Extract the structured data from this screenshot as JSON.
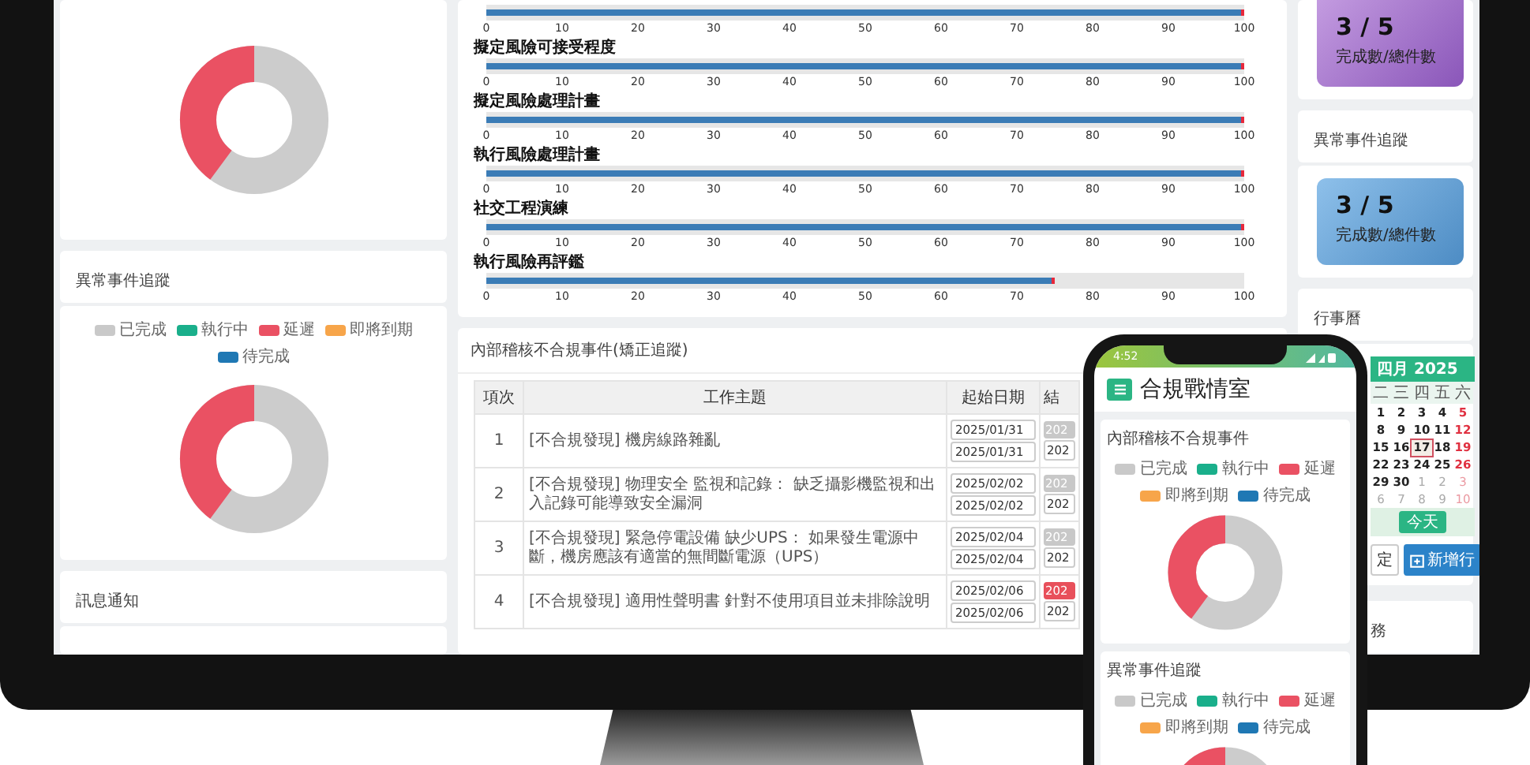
{
  "anomaly_card": {
    "title": "異常事件追蹤",
    "legend": [
      {
        "label": "已完成",
        "color": "#c9c9c9"
      },
      {
        "label": "執行中",
        "color": "#1aaf8b"
      },
      {
        "label": "延遲",
        "color": "#ea5163"
      },
      {
        "label": "即將到期",
        "color": "#f7a54a"
      },
      {
        "label": "待完成",
        "color": "#1f78b4"
      }
    ]
  },
  "notice_card": {
    "title": "訊息通知"
  },
  "risk_progress": [
    {
      "level": 1,
      "scale": [
        "0",
        "10",
        "20",
        "30",
        "40",
        "50",
        "60",
        "70",
        "80",
        "90",
        "100"
      ]
    },
    {
      "title": "擬定風險可接受程度",
      "level": 1,
      "scale": [
        "0",
        "10",
        "20",
        "30",
        "40",
        "50",
        "60",
        "70",
        "80",
        "90",
        "100"
      ]
    },
    {
      "title": "擬定風險處理計畫",
      "level": 1,
      "scale": [
        "0",
        "10",
        "20",
        "30",
        "40",
        "50",
        "60",
        "70",
        "80",
        "90",
        "100"
      ]
    },
    {
      "title": "執行風險處理計畫",
      "level": 1,
      "scale": [
        "0",
        "10",
        "20",
        "30",
        "40",
        "50",
        "60",
        "70",
        "80",
        "90",
        "100"
      ]
    },
    {
      "title": "社交工程演練",
      "level": 1,
      "scale": [
        "0",
        "10",
        "20",
        "30",
        "40",
        "50",
        "60",
        "70",
        "80",
        "90",
        "100"
      ]
    },
    {
      "title": "執行風險再評鑑",
      "level": 0.75,
      "scale": [
        "0",
        "10",
        "20",
        "30",
        "40",
        "50",
        "60",
        "70",
        "80",
        "90",
        "100"
      ]
    }
  ],
  "nonconformity_table": {
    "title": "內部稽核不合規事件(矯正追蹤)",
    "columns": [
      "項次",
      "工作主題",
      "起始日期",
      "結"
    ],
    "rows": [
      {
        "no": "1",
        "subject": "[不合規發現] 機房線路雜亂",
        "start_dates": [
          "2025/01/31",
          "2025/01/31"
        ],
        "end_badge": {
          "text": "202",
          "color": "#c8c8c8"
        },
        "end_date": "202"
      },
      {
        "no": "2",
        "subject": "[不合規發現] 物理安全 監視和記錄： 缺乏攝影機監視和出入記錄可能導致安全漏洞",
        "start_dates": [
          "2025/02/02",
          "2025/02/02"
        ],
        "end_badge": {
          "text": "202",
          "color": "#c8c8c8"
        },
        "end_date": "202"
      },
      {
        "no": "3",
        "subject": "[不合規發現] 緊急停電設備 缺少UPS： 如果發生電源中斷，機房應該有適當的無間斷電源（UPS）",
        "start_dates": [
          "2025/02/04",
          "2025/02/04"
        ],
        "end_badge": {
          "text": "202",
          "color": "#c8c8c8"
        },
        "end_date": "202"
      },
      {
        "no": "4",
        "subject": "[不合規發現] 適用性聲明書 針對不使用項目並未排除說明",
        "start_dates": [
          "2025/02/06",
          "2025/02/06"
        ],
        "end_badge": {
          "text": "202",
          "color": "#e8505b"
        },
        "end_date": "202"
      }
    ]
  },
  "top_stat": {
    "value": "3 / 5",
    "caption": "完成數/總件數"
  },
  "anomaly_stat_card": {
    "title": "異常事件追蹤",
    "value": "3 / 5",
    "caption": "完成數/總件數"
  },
  "calendar_card": {
    "title": "行事曆",
    "month": "四月 2025",
    "weekdays": [
      "二",
      "三",
      "四",
      "五",
      "六"
    ],
    "weeks": [
      [
        {
          "day": "1",
          "muted": false,
          "today": false,
          "weekend": false
        },
        {
          "day": "2",
          "muted": false,
          "today": false,
          "weekend": false
        },
        {
          "day": "3",
          "muted": false,
          "today": false,
          "weekend": false
        },
        {
          "day": "4",
          "muted": false,
          "today": false,
          "weekend": false
        },
        {
          "day": "5",
          "muted": false,
          "today": false,
          "weekend": true
        }
      ],
      [
        {
          "day": "8",
          "muted": false,
          "today": false,
          "weekend": false
        },
        {
          "day": "9",
          "muted": false,
          "today": false,
          "weekend": false
        },
        {
          "day": "10",
          "muted": false,
          "today": false,
          "weekend": false
        },
        {
          "day": "11",
          "muted": false,
          "today": false,
          "weekend": false
        },
        {
          "day": "12",
          "muted": false,
          "today": false,
          "weekend": true
        }
      ],
      [
        {
          "day": "15",
          "muted": false,
          "today": false,
          "weekend": false
        },
        {
          "day": "16",
          "muted": false,
          "today": false,
          "weekend": false
        },
        {
          "day": "17",
          "muted": false,
          "today": true,
          "weekend": false
        },
        {
          "day": "18",
          "muted": false,
          "today": false,
          "weekend": false
        },
        {
          "day": "19",
          "muted": false,
          "today": false,
          "weekend": true
        }
      ],
      [
        {
          "day": "22",
          "muted": false,
          "today": false,
          "weekend": false
        },
        {
          "day": "23",
          "muted": false,
          "today": false,
          "weekend": false
        },
        {
          "day": "24",
          "muted": false,
          "today": false,
          "weekend": false
        },
        {
          "day": "25",
          "muted": false,
          "today": false,
          "weekend": false
        },
        {
          "day": "26",
          "muted": false,
          "today": false,
          "weekend": true
        }
      ],
      [
        {
          "day": "29",
          "muted": false,
          "today": false,
          "weekend": false
        },
        {
          "day": "30",
          "muted": false,
          "today": false,
          "weekend": false
        },
        {
          "day": "1",
          "muted": true,
          "today": false,
          "weekend": false
        },
        {
          "day": "2",
          "muted": true,
          "today": false,
          "weekend": false
        },
        {
          "day": "3",
          "muted": true,
          "today": false,
          "weekend": true
        }
      ],
      [
        {
          "day": "6",
          "muted": true,
          "today": false,
          "weekend": false
        },
        {
          "day": "7",
          "muted": true,
          "today": false,
          "weekend": false
        },
        {
          "day": "8",
          "muted": true,
          "today": false,
          "weekend": false
        },
        {
          "day": "9",
          "muted": true,
          "today": false,
          "weekend": false
        },
        {
          "day": "10",
          "muted": true,
          "today": false,
          "weekend": true
        }
      ]
    ],
    "today_button": "今天",
    "buttons": [
      "定",
      "新增行"
    ]
  },
  "tasks_card": {
    "title": "務"
  },
  "phone": {
    "time": "4:52",
    "app_title": "合規戰情室",
    "cards": [
      {
        "title": "內部稽核不合規事件",
        "legend": [
          {
            "label": "已完成",
            "color": "#c9c9c9"
          },
          {
            "label": "執行中",
            "color": "#1aaf8b"
          },
          {
            "label": "延遲",
            "color": "#ea5163"
          },
          {
            "label": "即將到期",
            "color": "#f7a54a"
          },
          {
            "label": "待完成",
            "color": "#1f78b4"
          }
        ]
      },
      {
        "title": "異常事件追蹤",
        "legend": [
          {
            "label": "已完成",
            "color": "#c9c9c9"
          },
          {
            "label": "執行中",
            "color": "#1aaf8b"
          },
          {
            "label": "延遲",
            "color": "#ea5163"
          },
          {
            "label": "即將到期",
            "color": "#f7a54a"
          },
          {
            "label": "待完成",
            "color": "#1f78b4"
          }
        ]
      }
    ]
  }
}
